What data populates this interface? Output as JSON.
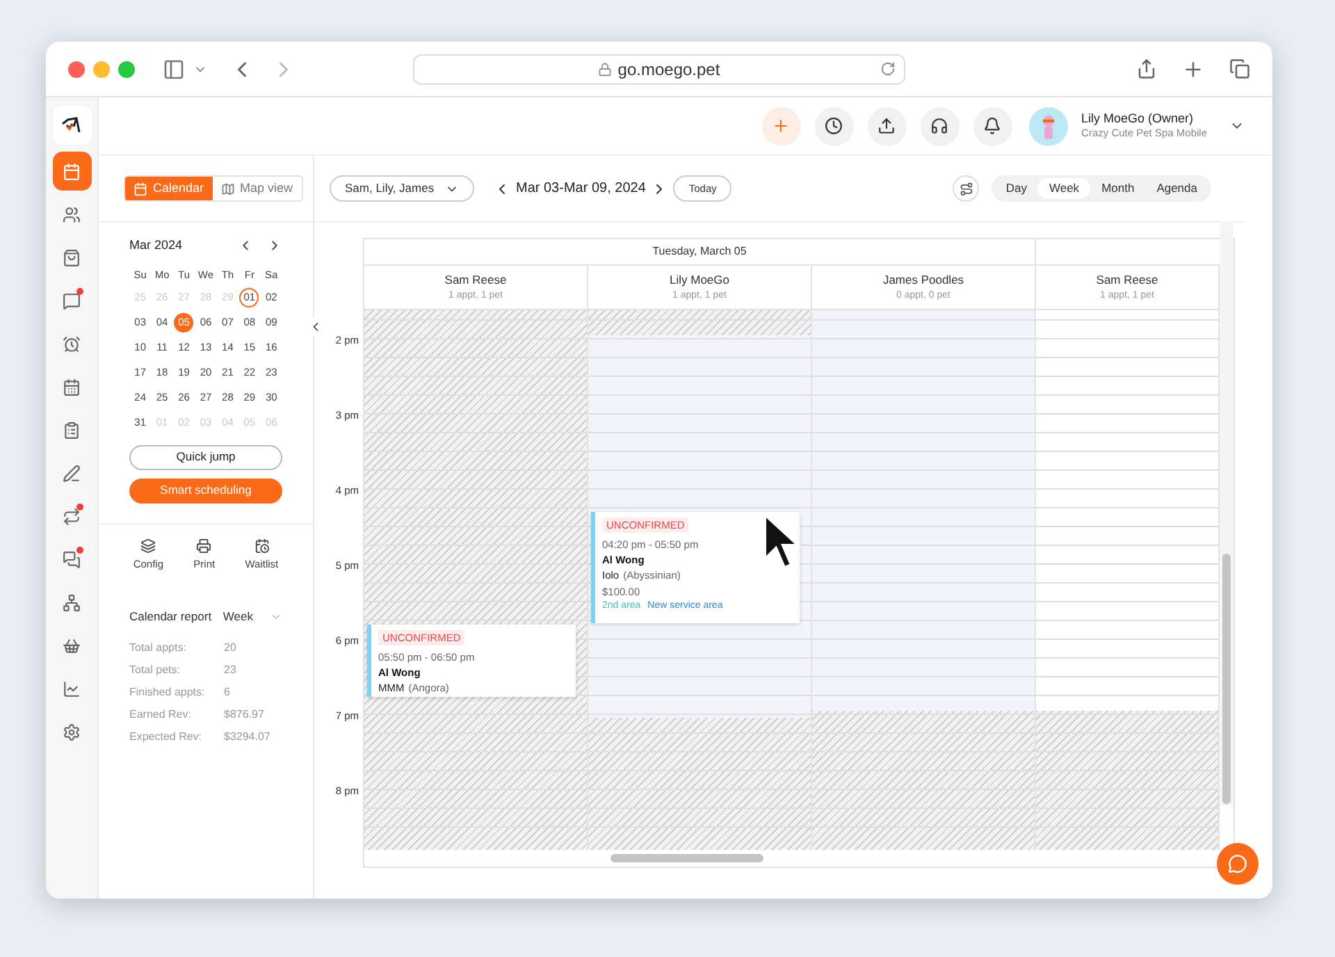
{
  "browser": {
    "url": "go.moego.pet"
  },
  "rail": [
    {
      "kind": "calendar",
      "selected": true,
      "badge": false
    },
    {
      "kind": "clients",
      "selected": false,
      "badge": false
    },
    {
      "kind": "bag",
      "selected": false,
      "badge": false
    },
    {
      "kind": "message",
      "selected": false,
      "badge": true
    },
    {
      "kind": "alarm",
      "selected": false,
      "badge": false
    },
    {
      "kind": "schedule",
      "selected": false,
      "badge": false
    },
    {
      "kind": "clipboard",
      "selected": false,
      "badge": false
    },
    {
      "kind": "pen",
      "selected": false,
      "badge": false
    },
    {
      "kind": "swap",
      "selected": false,
      "badge": true
    },
    {
      "kind": "chat",
      "selected": false,
      "badge": true
    },
    {
      "kind": "network",
      "selected": false,
      "badge": false
    },
    {
      "kind": "shop",
      "selected": false,
      "badge": false
    },
    {
      "kind": "chart",
      "selected": false,
      "badge": false
    },
    {
      "kind": "settings",
      "selected": false,
      "badge": false
    }
  ],
  "header": {
    "actions": [
      {
        "kind": "add"
      },
      {
        "kind": "clock"
      },
      {
        "kind": "upload"
      },
      {
        "kind": "support"
      },
      {
        "kind": "bell"
      }
    ],
    "user": {
      "name": "Lily MoeGo (Owner)",
      "business": "Crazy Cute Pet Spa Mobile"
    }
  },
  "view_toggle": [
    {
      "label": "Calendar",
      "kind": "calendar",
      "selected": true
    },
    {
      "label": "Map view",
      "kind": "map",
      "selected": false
    }
  ],
  "mini_calendar": {
    "title": "Mar 2024",
    "weekdays": [
      "Su",
      "Mo",
      "Tu",
      "We",
      "Th",
      "Fr",
      "Sa"
    ],
    "weeks": [
      [
        {
          "d": "25",
          "muted": true,
          "selected": false,
          "outlined": false
        },
        {
          "d": "26",
          "muted": true,
          "selected": false,
          "outlined": false
        },
        {
          "d": "27",
          "muted": true,
          "selected": false,
          "outlined": false
        },
        {
          "d": "28",
          "muted": true,
          "selected": false,
          "outlined": false
        },
        {
          "d": "29",
          "muted": true,
          "selected": false,
          "outlined": false
        },
        {
          "d": "01",
          "muted": false,
          "selected": false,
          "outlined": true
        },
        {
          "d": "02",
          "muted": false,
          "selected": false,
          "outlined": false
        }
      ],
      [
        {
          "d": "03",
          "muted": false,
          "selected": false,
          "outlined": false
        },
        {
          "d": "04",
          "muted": false,
          "selected": false,
          "outlined": false
        },
        {
          "d": "05",
          "muted": false,
          "selected": true,
          "outlined": false
        },
        {
          "d": "06",
          "muted": false,
          "selected": false,
          "outlined": false
        },
        {
          "d": "07",
          "muted": false,
          "selected": false,
          "outlined": false
        },
        {
          "d": "08",
          "muted": false,
          "selected": false,
          "outlined": false
        },
        {
          "d": "09",
          "muted": false,
          "selected": false,
          "outlined": false
        }
      ],
      [
        {
          "d": "10",
          "muted": false,
          "selected": false,
          "outlined": false
        },
        {
          "d": "11",
          "muted": false,
          "selected": false,
          "outlined": false
        },
        {
          "d": "12",
          "muted": false,
          "selected": false,
          "outlined": false
        },
        {
          "d": "13",
          "muted": false,
          "selected": false,
          "outlined": false
        },
        {
          "d": "14",
          "muted": false,
          "selected": false,
          "outlined": false
        },
        {
          "d": "15",
          "muted": false,
          "selected": false,
          "outlined": false
        },
        {
          "d": "16",
          "muted": false,
          "selected": false,
          "outlined": false
        }
      ],
      [
        {
          "d": "17",
          "muted": false,
          "selected": false,
          "outlined": false
        },
        {
          "d": "18",
          "muted": false,
          "selected": false,
          "outlined": false
        },
        {
          "d": "19",
          "muted": false,
          "selected": false,
          "outlined": false
        },
        {
          "d": "20",
          "muted": false,
          "selected": false,
          "outlined": false
        },
        {
          "d": "21",
          "muted": false,
          "selected": false,
          "outlined": false
        },
        {
          "d": "22",
          "muted": false,
          "selected": false,
          "outlined": false
        },
        {
          "d": "23",
          "muted": false,
          "selected": false,
          "outlined": false
        }
      ],
      [
        {
          "d": "24",
          "muted": false,
          "selected": false,
          "outlined": false
        },
        {
          "d": "25",
          "muted": false,
          "selected": false,
          "outlined": false
        },
        {
          "d": "26",
          "muted": false,
          "selected": false,
          "outlined": false
        },
        {
          "d": "27",
          "muted": false,
          "selected": false,
          "outlined": false
        },
        {
          "d": "28",
          "muted": false,
          "selected": false,
          "outlined": false
        },
        {
          "d": "29",
          "muted": false,
          "selected": false,
          "outlined": false
        },
        {
          "d": "30",
          "muted": false,
          "selected": false,
          "outlined": false
        }
      ],
      [
        {
          "d": "31",
          "muted": false,
          "selected": false,
          "outlined": false
        },
        {
          "d": "01",
          "muted": true,
          "selected": false,
          "outlined": false
        },
        {
          "d": "02",
          "muted": true,
          "selected": false,
          "outlined": false
        },
        {
          "d": "03",
          "muted": true,
          "selected": false,
          "outlined": false
        },
        {
          "d": "04",
          "muted": true,
          "selected": false,
          "outlined": false
        },
        {
          "d": "05",
          "muted": true,
          "selected": false,
          "outlined": false
        },
        {
          "d": "06",
          "muted": true,
          "selected": false,
          "outlined": false
        }
      ]
    ]
  },
  "buttons": [
    {
      "label": "Quick jump",
      "kind": "outline"
    },
    {
      "label": "Smart scheduling",
      "kind": "primary"
    }
  ],
  "tools": [
    {
      "label": "Config",
      "kind": "layers"
    },
    {
      "label": "Print",
      "kind": "print"
    },
    {
      "label": "Waitlist",
      "kind": "waitlist"
    }
  ],
  "report": {
    "title": "Calendar report",
    "period": "Week",
    "rows": [
      {
        "label": "Total appts:",
        "value": "20"
      },
      {
        "label": "Total pets:",
        "value": "23"
      },
      {
        "label": "Finished appts:",
        "value": "6"
      },
      {
        "label": "Earned Rev:",
        "value": "$876.97"
      },
      {
        "label": "Expected Rev:",
        "value": "$3294.07"
      }
    ]
  },
  "toolbar": {
    "staff": "Sam, Lily, James",
    "range": "Mar 03-Mar 09, 2024",
    "today": "Today",
    "views": [
      {
        "label": "Day",
        "selected": false
      },
      {
        "label": "Week",
        "selected": true
      },
      {
        "label": "Month",
        "selected": false
      },
      {
        "label": "Agenda",
        "selected": false
      }
    ]
  },
  "grid": {
    "date": "Tuesday, March 05",
    "hours": [
      "2 pm",
      "3 pm",
      "4 pm",
      "5 pm",
      "6 pm",
      "7 pm",
      "8 pm"
    ],
    "columns": [
      {
        "name": "Sam Reese",
        "summary": "1 appt, 1 pet",
        "events": [
          {
            "status": "UNCONFIRMED",
            "time": "05:50 pm - 06:50 pm",
            "client": "Al Wong",
            "pet": "MMM",
            "breed": "(Angora)"
          }
        ]
      },
      {
        "name": "Lily MoeGo",
        "summary": "1 appt, 1 pet",
        "events": [
          {
            "status": "UNCONFIRMED",
            "time": "04:20 pm - 05:50 pm",
            "client": "Al Wong",
            "pet": "Iolo",
            "breed": "(Abyssinian)",
            "price": "$100.00",
            "tags": [
              {
                "label": "2nd area",
                "color": "#2ec4c4"
              },
              {
                "label": "New service area",
                "color": "#1e88e5"
              }
            ]
          }
        ]
      },
      {
        "name": "James Poodles",
        "summary": "0 appt, 0 pet"
      },
      {
        "name": "Sam Reese",
        "summary": "1 appt, 1 pet"
      }
    ]
  }
}
